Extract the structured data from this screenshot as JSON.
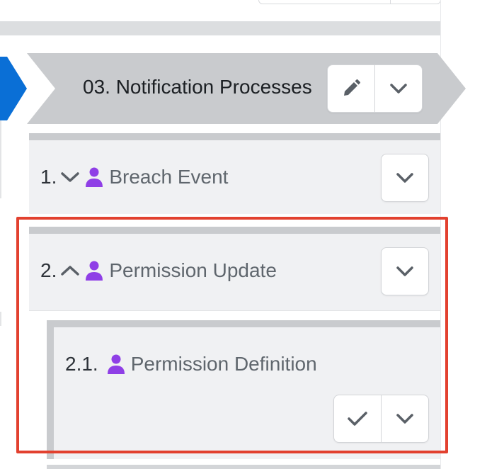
{
  "stage": {
    "title": "03. Notification Processes"
  },
  "items": [
    {
      "number": "1.",
      "label": "Breach Event"
    },
    {
      "number": "2.",
      "label": "Permission Update"
    },
    {
      "number": "2.1.",
      "label": "Permission Definition"
    }
  ],
  "colors": {
    "accent_blue": "#0a6fd6",
    "stage_gray": "#c9cbce",
    "card_bg": "#f0f1f3",
    "person_purple": "#8f3fe6",
    "highlight_red": "#e2412f"
  },
  "icons": [
    "pencil-icon",
    "chevron-down-icon",
    "chevron-up-icon",
    "person-icon",
    "checkmark-icon"
  ]
}
